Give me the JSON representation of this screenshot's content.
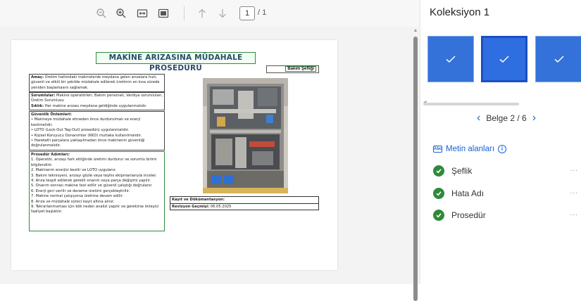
{
  "toolbar": {
    "page_current": "1",
    "page_total": "/ 1"
  },
  "document": {
    "title": "MAKİNE ARIZASINA MÜDAHALE PROSEDÜRÜ",
    "author_label": "Bakım Şefliği",
    "block1_label": "Amaç:",
    "block1_text": "Üretim hattındaki makinelerde meydana gelen arızalara hızlı, güvenli ve etkili bir şekilde müdahale edilerek üretimin en kısa sürede yeniden başlamasını sağlamak.",
    "block2_label1": "Sorumlular:",
    "block2_text1": "Makine operatörleri, Bakım personeli, Vardiya sorumluları, Üretim Sorumlusu",
    "block2_label2": "Sıklık:",
    "block2_text2": "Her makine arızası meydana geldiğinde uygulanmalıdır.",
    "block3_label": "Güvenlik Önlemleri:",
    "block3_items": [
      "• Makineye müdahale etmeden önce durdurulmalı ve enerji kesilmelidir.",
      "• LOTO (Lock-Out Tag-Out) prosedürü uygulanmalıdır.",
      "• Kişisel Koruyucu Donanımlar (KKD) mutlaka kullanılmalıdır.",
      "• Hareketli parçalara yaklaşılmadan önce makinenin güvenliği doğrulanmalıdır."
    ],
    "block4_label": "Prosedür Adımları:",
    "block4_items": [
      "1. Operatör, arızayı fark ettiğinde üretimi durdurur ve sorumlu birimi bilgilendirir.",
      "2. Makinenin enerjisi kesilir ve LOTO uygulanır.",
      "3. Bakım teknisyeni, arızayı gözle veya teşhis ekipmanlarıyla inceler.",
      "4. Arıza tespit edilerek gerekli onarım veya parça değişimi yapılır.",
      "5. Onarım sonrası makine test edilir ve güvenli çalıştığı doğrulanır.",
      "6. Enerji geri verilir ve deneme üretimi gerçekleştirilir.",
      "7. Makine normal çalışıyorsa üretime devam edilir.",
      "8. Arıza ve müdahale süreci kayıt altına alınır.",
      "9. Tekrarlanmaması için kök neden analizi yapılır ve gerekirse önleyici faaliyet başlatılır."
    ],
    "table_row1_label": "Kayıt ve Dökümantasyon:",
    "table_row2_label": "Revizyon Geçmişi:",
    "table_row2_value": "06.05.2025"
  },
  "panel": {
    "title": "Koleksiyon 1",
    "belge_label": "Belge 2 / 6",
    "fields_title": "Metin alanları",
    "fields": [
      {
        "name": "Şeflik"
      },
      {
        "name": "Hata Adı"
      },
      {
        "name": "Prosedür"
      }
    ],
    "more_label": "..."
  },
  "colors": {
    "accent": "#1a62d6",
    "check_green": "#2f8a3a",
    "thumb_blue": "#3472d9",
    "thumb_selected_border": "#1a4fc2"
  },
  "icons": {
    "zoom_out": "zoom-out-icon",
    "zoom_in": "zoom-in-icon",
    "fit_width": "fit-width-icon",
    "fit_page": "fit-page-icon",
    "page_up": "arrow-up-icon",
    "page_down": "arrow-down-icon",
    "info": "info-icon",
    "check": "check-icon"
  }
}
